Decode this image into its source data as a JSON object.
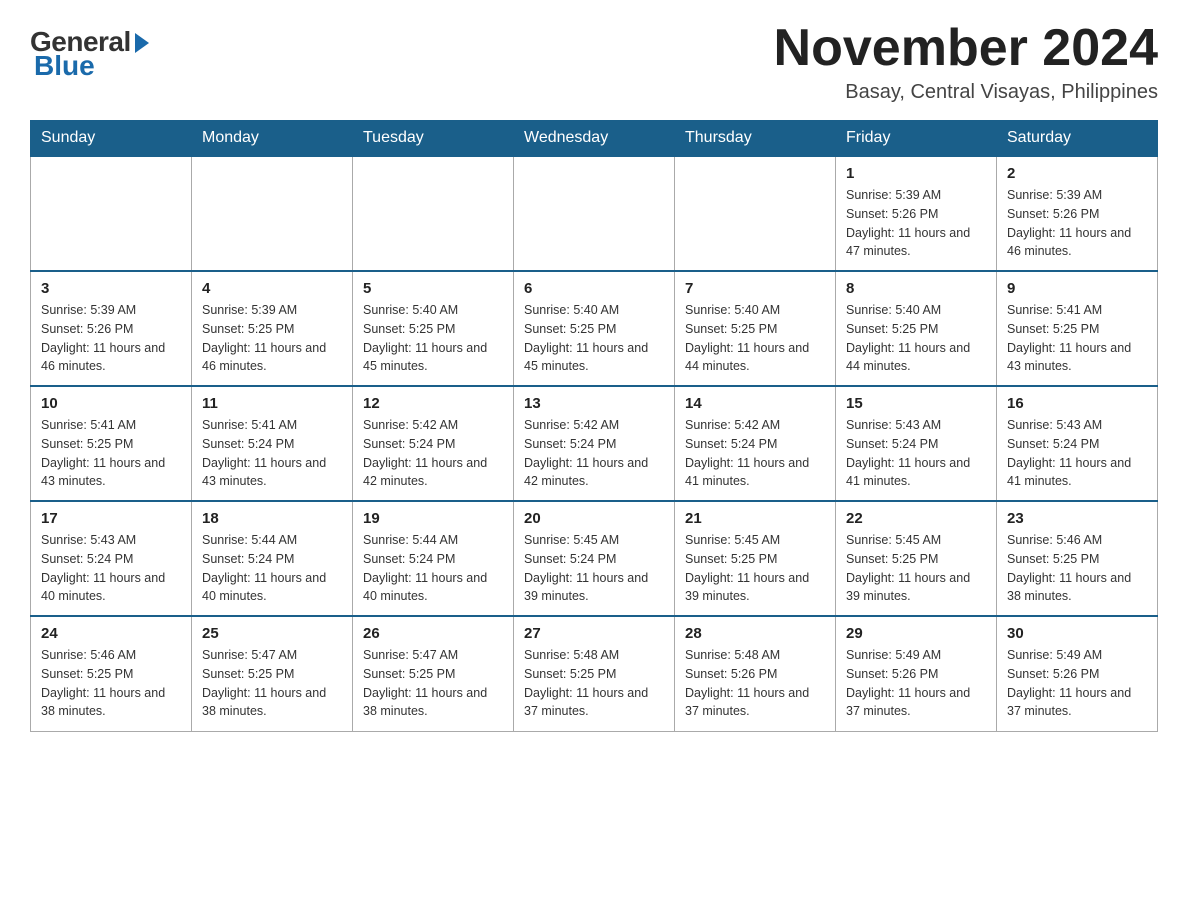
{
  "logo": {
    "general": "General",
    "blue": "Blue"
  },
  "title": {
    "month": "November 2024",
    "location": "Basay, Central Visayas, Philippines"
  },
  "weekdays": [
    "Sunday",
    "Monday",
    "Tuesday",
    "Wednesday",
    "Thursday",
    "Friday",
    "Saturday"
  ],
  "weeks": [
    [
      {
        "day": "",
        "info": ""
      },
      {
        "day": "",
        "info": ""
      },
      {
        "day": "",
        "info": ""
      },
      {
        "day": "",
        "info": ""
      },
      {
        "day": "",
        "info": ""
      },
      {
        "day": "1",
        "info": "Sunrise: 5:39 AM\nSunset: 5:26 PM\nDaylight: 11 hours and 47 minutes."
      },
      {
        "day": "2",
        "info": "Sunrise: 5:39 AM\nSunset: 5:26 PM\nDaylight: 11 hours and 46 minutes."
      }
    ],
    [
      {
        "day": "3",
        "info": "Sunrise: 5:39 AM\nSunset: 5:26 PM\nDaylight: 11 hours and 46 minutes."
      },
      {
        "day": "4",
        "info": "Sunrise: 5:39 AM\nSunset: 5:25 PM\nDaylight: 11 hours and 46 minutes."
      },
      {
        "day": "5",
        "info": "Sunrise: 5:40 AM\nSunset: 5:25 PM\nDaylight: 11 hours and 45 minutes."
      },
      {
        "day": "6",
        "info": "Sunrise: 5:40 AM\nSunset: 5:25 PM\nDaylight: 11 hours and 45 minutes."
      },
      {
        "day": "7",
        "info": "Sunrise: 5:40 AM\nSunset: 5:25 PM\nDaylight: 11 hours and 44 minutes."
      },
      {
        "day": "8",
        "info": "Sunrise: 5:40 AM\nSunset: 5:25 PM\nDaylight: 11 hours and 44 minutes."
      },
      {
        "day": "9",
        "info": "Sunrise: 5:41 AM\nSunset: 5:25 PM\nDaylight: 11 hours and 43 minutes."
      }
    ],
    [
      {
        "day": "10",
        "info": "Sunrise: 5:41 AM\nSunset: 5:25 PM\nDaylight: 11 hours and 43 minutes."
      },
      {
        "day": "11",
        "info": "Sunrise: 5:41 AM\nSunset: 5:24 PM\nDaylight: 11 hours and 43 minutes."
      },
      {
        "day": "12",
        "info": "Sunrise: 5:42 AM\nSunset: 5:24 PM\nDaylight: 11 hours and 42 minutes."
      },
      {
        "day": "13",
        "info": "Sunrise: 5:42 AM\nSunset: 5:24 PM\nDaylight: 11 hours and 42 minutes."
      },
      {
        "day": "14",
        "info": "Sunrise: 5:42 AM\nSunset: 5:24 PM\nDaylight: 11 hours and 41 minutes."
      },
      {
        "day": "15",
        "info": "Sunrise: 5:43 AM\nSunset: 5:24 PM\nDaylight: 11 hours and 41 minutes."
      },
      {
        "day": "16",
        "info": "Sunrise: 5:43 AM\nSunset: 5:24 PM\nDaylight: 11 hours and 41 minutes."
      }
    ],
    [
      {
        "day": "17",
        "info": "Sunrise: 5:43 AM\nSunset: 5:24 PM\nDaylight: 11 hours and 40 minutes."
      },
      {
        "day": "18",
        "info": "Sunrise: 5:44 AM\nSunset: 5:24 PM\nDaylight: 11 hours and 40 minutes."
      },
      {
        "day": "19",
        "info": "Sunrise: 5:44 AM\nSunset: 5:24 PM\nDaylight: 11 hours and 40 minutes."
      },
      {
        "day": "20",
        "info": "Sunrise: 5:45 AM\nSunset: 5:24 PM\nDaylight: 11 hours and 39 minutes."
      },
      {
        "day": "21",
        "info": "Sunrise: 5:45 AM\nSunset: 5:25 PM\nDaylight: 11 hours and 39 minutes."
      },
      {
        "day": "22",
        "info": "Sunrise: 5:45 AM\nSunset: 5:25 PM\nDaylight: 11 hours and 39 minutes."
      },
      {
        "day": "23",
        "info": "Sunrise: 5:46 AM\nSunset: 5:25 PM\nDaylight: 11 hours and 38 minutes."
      }
    ],
    [
      {
        "day": "24",
        "info": "Sunrise: 5:46 AM\nSunset: 5:25 PM\nDaylight: 11 hours and 38 minutes."
      },
      {
        "day": "25",
        "info": "Sunrise: 5:47 AM\nSunset: 5:25 PM\nDaylight: 11 hours and 38 minutes."
      },
      {
        "day": "26",
        "info": "Sunrise: 5:47 AM\nSunset: 5:25 PM\nDaylight: 11 hours and 38 minutes."
      },
      {
        "day": "27",
        "info": "Sunrise: 5:48 AM\nSunset: 5:25 PM\nDaylight: 11 hours and 37 minutes."
      },
      {
        "day": "28",
        "info": "Sunrise: 5:48 AM\nSunset: 5:26 PM\nDaylight: 11 hours and 37 minutes."
      },
      {
        "day": "29",
        "info": "Sunrise: 5:49 AM\nSunset: 5:26 PM\nDaylight: 11 hours and 37 minutes."
      },
      {
        "day": "30",
        "info": "Sunrise: 5:49 AM\nSunset: 5:26 PM\nDaylight: 11 hours and 37 minutes."
      }
    ]
  ]
}
